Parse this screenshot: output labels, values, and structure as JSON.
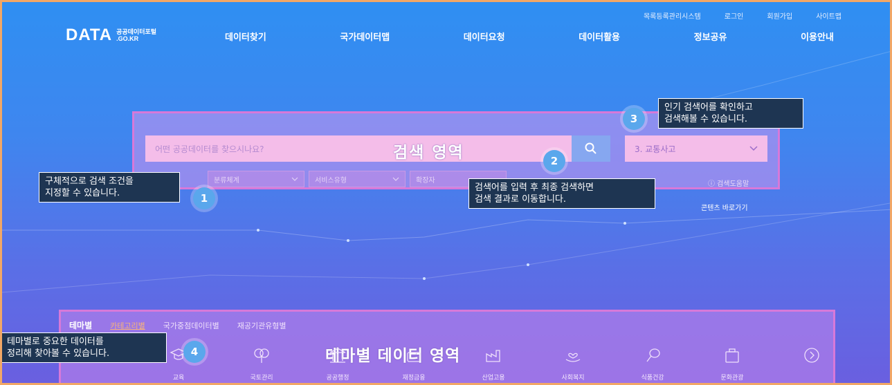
{
  "utility_nav": [
    "목록등록관리시스템",
    "로그인",
    "회원가입",
    "사이트맵"
  ],
  "logo": {
    "main": "DATA",
    "sub_top": "공공데이터포털",
    "sub_bottom": ".GO.KR"
  },
  "main_nav": [
    "데이터찾기",
    "국가데이터맵",
    "데이터요청",
    "데이터활용",
    "정보공유",
    "이용안내"
  ],
  "search": {
    "placeholder": "어떤 공공데이터를 찾으시나요?",
    "area_label": "검색 영역",
    "popular_selected": "3. 교통사고",
    "filters": [
      "분류체계",
      "서비스유형",
      "확장자"
    ],
    "help": "ⓘ 검색도움말",
    "shortcut": "콘텐츠 바로가기"
  },
  "callouts": {
    "c1": {
      "badge": "1",
      "line1": "구체적으로 검색 조건을",
      "line2": "지정할 수 있습니다."
    },
    "c2": {
      "badge": "2",
      "line1": "검색어를 입력 후 최종 검색하면",
      "line2": "검색 결과로 이동합니다."
    },
    "c3": {
      "badge": "3",
      "line1": "인기 검색어를 확인하고",
      "line2": "검색해볼 수 있습니다."
    },
    "c4": {
      "badge": "4",
      "line1": "테마별로 중요한 데이터를",
      "line2": "정리해 찾아볼 수 있습니다."
    }
  },
  "theme": {
    "tabs": [
      "테마별",
      "카테고리별",
      "국가중점데이터별",
      "재공기관유형별"
    ],
    "area_label": "테마별 데이터 영역",
    "categories": [
      "교육",
      "국토관리",
      "공공행정",
      "재정금융",
      "산업고용",
      "사회복지",
      "식품건강",
      "문화관광"
    ]
  },
  "colors": {
    "frame_border": "#f2a766",
    "highlight_border": "#d779d9",
    "callout_bg": "#1e3552",
    "badge": "#5aa7ec"
  }
}
